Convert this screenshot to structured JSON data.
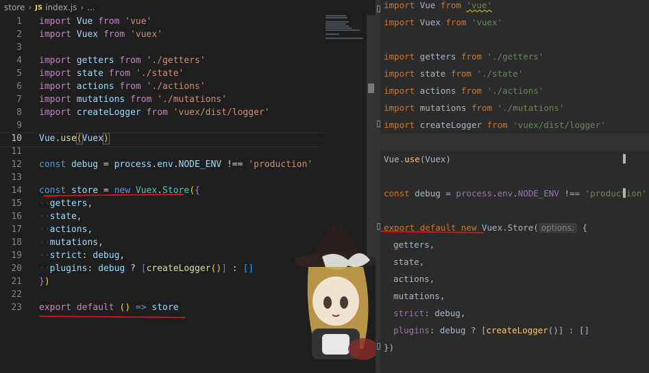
{
  "left_editor": {
    "breadcrumb": [
      "store",
      "JS",
      "index.js",
      "..."
    ],
    "line_numbers": [
      "1",
      "2",
      "3",
      "4",
      "5",
      "6",
      "7",
      "8",
      "9",
      "10",
      "11",
      "12",
      "13",
      "14",
      "15",
      "16",
      "17",
      "18",
      "19",
      "20",
      "21",
      "22",
      "23"
    ],
    "code": {
      "l1": [
        "import",
        " ",
        "Vue",
        " ",
        "from",
        " ",
        "'vue'"
      ],
      "l2": [
        "import",
        " ",
        "Vuex",
        " ",
        "from",
        " ",
        "'vuex'"
      ],
      "l4": [
        "import",
        " ",
        "getters",
        " ",
        "from",
        " ",
        "'./getters'"
      ],
      "l5": [
        "import",
        " ",
        "state",
        " ",
        "from",
        " ",
        "'./state'"
      ],
      "l6": [
        "import",
        " ",
        "actions",
        " ",
        "from",
        " ",
        "'./actions'"
      ],
      "l7": [
        "import",
        " ",
        "mutations",
        " ",
        "from",
        " ",
        "'./mutations'"
      ],
      "l8": [
        "import",
        " ",
        "createLogger",
        " ",
        "from",
        " ",
        "'vuex/dist/logger'"
      ],
      "l10": [
        "Vue",
        ".",
        "use",
        "(",
        "Vuex",
        ")"
      ],
      "l12": [
        "const",
        " ",
        "debug",
        " = ",
        "process",
        ".",
        "env",
        ".",
        "NODE_ENV",
        " !== ",
        "'production'"
      ],
      "l14": [
        "const",
        " ",
        "store",
        " = ",
        "new",
        " ",
        "Vuex",
        ".",
        "Store",
        "(",
        "{"
      ],
      "l15": "getters,",
      "l16": "state,",
      "l17": "actions,",
      "l18": "mutations,",
      "l19": [
        "strict",
        ": ",
        "debug",
        ","
      ],
      "l20": [
        "plugins",
        ": ",
        "debug",
        " ? ",
        "[",
        "createLogger",
        "(",
        ")",
        "]",
        " : ",
        "[",
        "]"
      ],
      "l21": [
        "}",
        ")"
      ],
      "l23": [
        "export",
        " ",
        "default",
        " ",
        "(",
        ")",
        " => ",
        "store"
      ]
    }
  },
  "right_editor": {
    "lines": {
      "r1": [
        "import",
        " Vue ",
        "from",
        " ",
        "'vue'"
      ],
      "r2": [
        "import",
        " Vuex ",
        "from",
        " ",
        "'vuex'"
      ],
      "r4": [
        "import",
        " getters ",
        "from",
        " ",
        "'./getters'"
      ],
      "r5": [
        "import",
        " state ",
        "from",
        " ",
        "'./state'"
      ],
      "r6": [
        "import",
        " actions ",
        "from",
        " ",
        "'./actions'"
      ],
      "r7": [
        "import",
        " mutations ",
        "from",
        " ",
        "'./mutations'"
      ],
      "r8": [
        "import",
        " createLogger ",
        "from",
        " ",
        "'vuex/dist/logger'"
      ],
      "r10": [
        "Vue.",
        "use",
        "(Vuex)"
      ],
      "r12": [
        "const",
        " debug = ",
        "process",
        ".",
        "env",
        ".",
        "NODE_ENV",
        " !== ",
        "'production'"
      ],
      "r14": [
        "export",
        " ",
        "default",
        " ",
        "new",
        " Vuex.Store(",
        "options:",
        " {"
      ],
      "r15": "getters,",
      "r16": "state,",
      "r17": "actions,",
      "r18": "mutations,",
      "r19": [
        "strict",
        ": debug,"
      ],
      "r20": [
        "plugins",
        ": debug ? [",
        "createLogger",
        "()] : []"
      ],
      "r21": "})"
    }
  },
  "colors": {
    "red_underline": "#e0121c",
    "vscode_bg": "#1e1e1e",
    "jetbrains_bg": "#2b2b2b"
  }
}
